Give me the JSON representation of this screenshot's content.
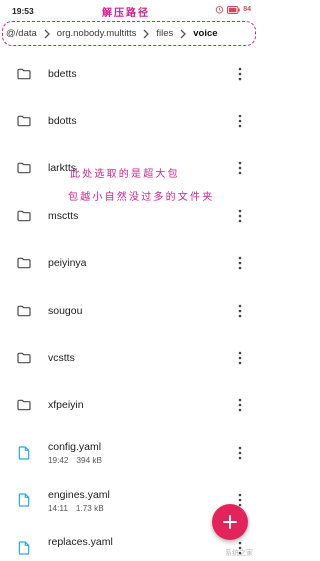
{
  "status_bar": {
    "time": "19:53",
    "battery": "84"
  },
  "annotations": {
    "top": "解压路径",
    "middle_line1": "此处选取的是超大包",
    "middle_line2": "包越小自然没过多的文件夹"
  },
  "breadcrumb": [
    "@/data",
    "org.nobody.multitts",
    "files",
    "voice"
  ],
  "folders": [
    {
      "name": "bdetts",
      "icon": "folder-icon"
    },
    {
      "name": "bdotts",
      "icon": "folder-icon"
    },
    {
      "name": "larktts",
      "icon": "folder-icon"
    },
    {
      "name": "msctts",
      "icon": "folder-icon"
    },
    {
      "name": "peiyinya",
      "icon": "folder-icon"
    },
    {
      "name": "sougou",
      "icon": "folder-icon"
    },
    {
      "name": "vcstts",
      "icon": "folder-icon"
    },
    {
      "name": "xfpeiyin",
      "icon": "folder-icon"
    }
  ],
  "files": [
    {
      "name": "config.yaml",
      "time": "19:42",
      "size": "394 kB",
      "icon": "file-icon"
    },
    {
      "name": "engines.yaml",
      "time": "14:11",
      "size": "1.73 kB",
      "icon": "file-icon"
    },
    {
      "name": "replaces.yaml",
      "icon": "file-icon"
    }
  ],
  "fab": {
    "label": "+"
  },
  "watermark": "系统之家",
  "colors": {
    "accent": "#e2245a",
    "annotation": "#d21e8f",
    "file_icon": "#2ba7e0",
    "folder_icon": "#4a4a4a"
  }
}
